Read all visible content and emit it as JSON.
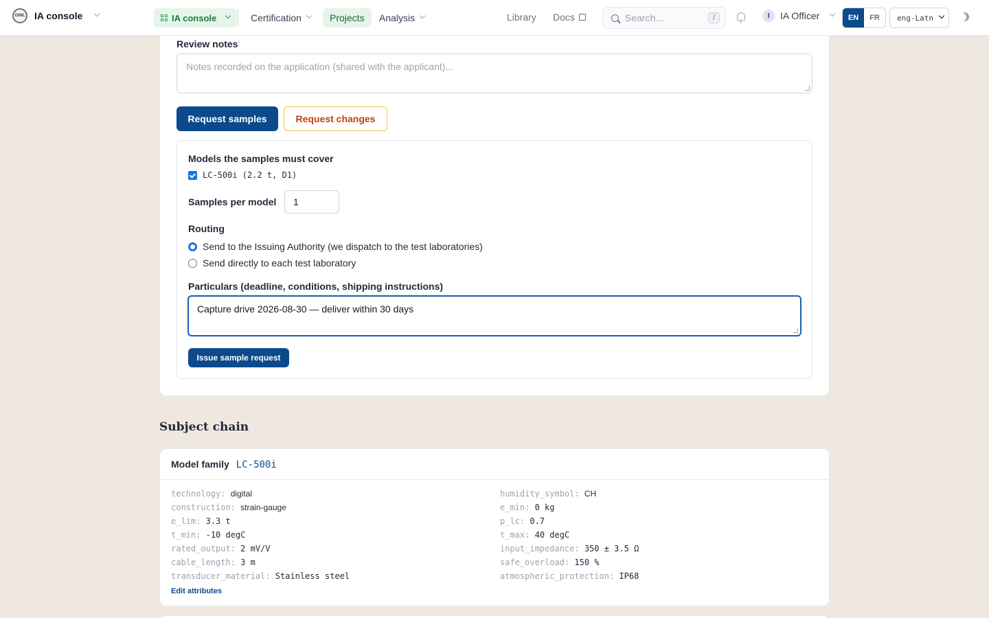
{
  "topbar": {
    "brand": "IA console",
    "brand_logo_text": "OIML",
    "workspace": "IA console",
    "nav": {
      "certification": "Certification",
      "projects": "Projects",
      "analysis": "Analysis"
    },
    "library": "Library",
    "docs": "Docs",
    "search": {
      "placeholder": "Search...",
      "shortcut": "/"
    },
    "user": {
      "initial": "I",
      "name": "IA Officer"
    },
    "lang": {
      "en": "EN",
      "fr": "FR",
      "script": "eng-Latn"
    }
  },
  "review": {
    "label": "Review notes",
    "placeholder": "Notes recorded on the application (shared with the applicant)..."
  },
  "actions": {
    "request_samples": "Request samples",
    "request_changes": "Request changes"
  },
  "sample_request": {
    "models_title": "Models the samples must cover",
    "model": "LC-500i (2.2 t, D1)",
    "samples_per_model_label": "Samples per model",
    "samples_per_model": "1",
    "routing_label": "Routing",
    "routing_options": [
      "Send to the Issuing Authority (we dispatch to the test laboratories)",
      "Send directly to each test laboratory"
    ],
    "particulars_label": "Particulars (deadline, conditions, shipping instructions)",
    "particulars_value": "Capture drive 2026-08-30 — deliver within 30 days",
    "issue_button": "Issue sample request"
  },
  "subject_chain": {
    "title": "Subject chain",
    "family_label": "Model family",
    "family_code": "LC-500i",
    "attributes_left": [
      {
        "key": "technology:",
        "value": "digital"
      },
      {
        "key": "construction:",
        "value": "strain-gauge"
      },
      {
        "key": "e_lim:",
        "value": "3.3 t"
      },
      {
        "key": "t_min:",
        "value": "-10 degC"
      },
      {
        "key": "rated_output:",
        "value": "2 mV/V"
      },
      {
        "key": "cable_length:",
        "value": "3 m"
      },
      {
        "key": "transducer_material:",
        "value": "Stainless steel"
      }
    ],
    "attributes_right": [
      {
        "key": "humidity_symbol:",
        "value": "CH"
      },
      {
        "key": "e_min:",
        "value": "0 kg"
      },
      {
        "key": "p_lc:",
        "value": "0.7"
      },
      {
        "key": "t_max:",
        "value": "40 degC"
      },
      {
        "key": "input_impedance:",
        "value": "350 ± 3.5 Ω"
      },
      {
        "key": "safe_overload:",
        "value": "150 %"
      },
      {
        "key": "atmospheric_protection:",
        "value": "IP68"
      }
    ],
    "edit_link": "Edit attributes"
  }
}
